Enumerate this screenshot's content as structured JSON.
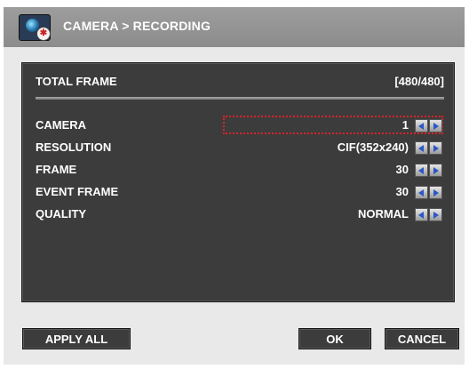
{
  "window": {
    "title": "CAMERA > RECORDING",
    "icon": "camera-settings-icon"
  },
  "panel": {
    "total_frame": {
      "label": "TOTAL FRAME",
      "value": "[480/480]"
    },
    "rows": [
      {
        "label": "CAMERA",
        "value": "1"
      },
      {
        "label": "RESOLUTION",
        "value": "CIF(352x240)"
      },
      {
        "label": "FRAME",
        "value": "30"
      },
      {
        "label": "EVENT FRAME",
        "value": "30"
      },
      {
        "label": "QUALITY",
        "value": "NORMAL"
      }
    ],
    "selected_row": "CAMERA"
  },
  "buttons": {
    "apply_all": "APPLY ALL",
    "ok": "OK",
    "cancel": "CANCEL"
  },
  "colors": {
    "title_bar": "#959595",
    "panel_bg": "#3c3c3c",
    "selection_border": "#d8232a",
    "arrow_glyph": "#2b57c7"
  }
}
